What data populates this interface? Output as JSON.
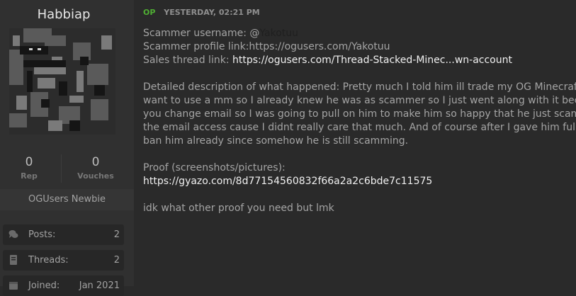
{
  "profile": {
    "username": "Habbiap",
    "rep_value": "0",
    "rep_label": "Rep",
    "vouches_value": "0",
    "vouches_label": "Vouches",
    "rank": "OGUsers Newbie",
    "info": [
      {
        "key": "Posts:",
        "value": "2",
        "icon": "comments-icon"
      },
      {
        "key": "Threads:",
        "value": "2",
        "icon": "book-icon"
      },
      {
        "key": "Joined:",
        "value": "Jan 2021",
        "icon": "calendar-icon"
      }
    ]
  },
  "post": {
    "op_badge": "OP",
    "timestamp": "YESTERDAY, 02:21 PM",
    "scammer_username_label": "Scammer username: @",
    "scammer_username": "Yakotuu",
    "profile_link_line": "Scammer profile link:https://ogusers.com/Yakotuu",
    "sales_thread_label": "Sales thread link: ",
    "sales_thread_link": "https://ogusers.com/Thread-Stacked-Minec...wn-account",
    "description": [
      "Detailed description of what happened: Pretty much I told him ill trade my OG Minecraft",
      "want to use a mm so I already knew he was as scammer so I just went along with it bec",
      "you change email so I was going to pull on him to make him so happy that he just scam",
      "the email access cause I didnt really care that much. And of course after I gave him full",
      "ban him already since somehow he is still scamming."
    ],
    "proof_label": "Proof (screenshots/pictures):",
    "proof_link": "https://gyazo.com/8d77154560832f66a2a2c6bde7c11575",
    "closing": "idk what other proof you need but lmk"
  },
  "colors": {
    "background": "#2a2a2a",
    "sidebar": "#303030",
    "op_badge": "#4fae33",
    "link": "#f0f0f0"
  }
}
